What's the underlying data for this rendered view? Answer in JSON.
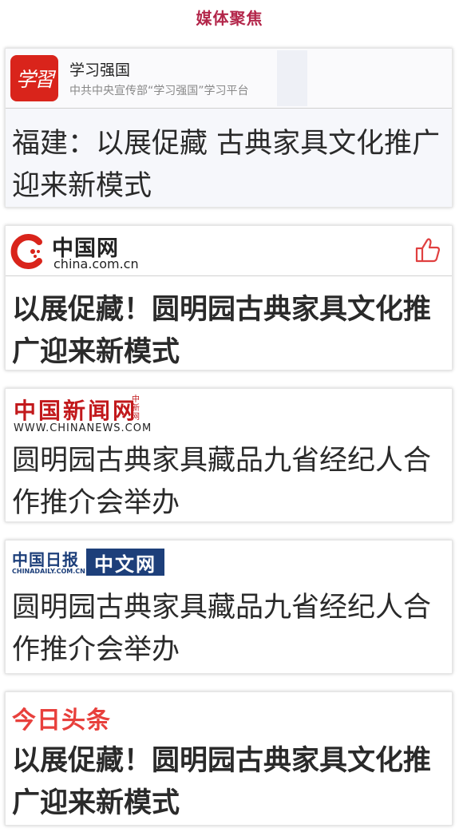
{
  "page": {
    "title": "媒体聚焦"
  },
  "colors": {
    "title": "#b3264a",
    "xuexi": "#d9241b",
    "chinanews": "#c2191c",
    "chinadaily": "#1d3f7a",
    "toutiao": "#e8403c"
  },
  "cards": [
    {
      "source": {
        "name": "学习强国",
        "subtitle": "中共中央宣传部“学习强国”学习平台",
        "logo_text": "学習",
        "icon": "xuexi-logo-icon"
      },
      "headline": "福建：以展促藏 古典家具文化推广迎来新模式"
    },
    {
      "source": {
        "name": "中国网",
        "domain": "china.com.cn",
        "icon": "china-com-cn-logo-icon",
        "action_icon": "thumbs-up-icon"
      },
      "headline": "以展促藏！圆明园古典家具文化推广迎来新模式"
    },
    {
      "source": {
        "name": "中国新闻网",
        "vertical": "中新网",
        "url": "WWW.CHINANEWS.COM"
      },
      "headline": "圆明园古典家具藏品九省经纪人合作推介会举办"
    },
    {
      "source": {
        "name": "中国日报",
        "url": "CHINADAILY.COM.CN",
        "badge": "中文网"
      },
      "headline": "圆明园古典家具藏品九省经纪人合作推介会举办"
    },
    {
      "source": {
        "name": "今日头条"
      },
      "headline": "以展促藏！圆明园古典家具文化推广迎来新模式"
    }
  ]
}
